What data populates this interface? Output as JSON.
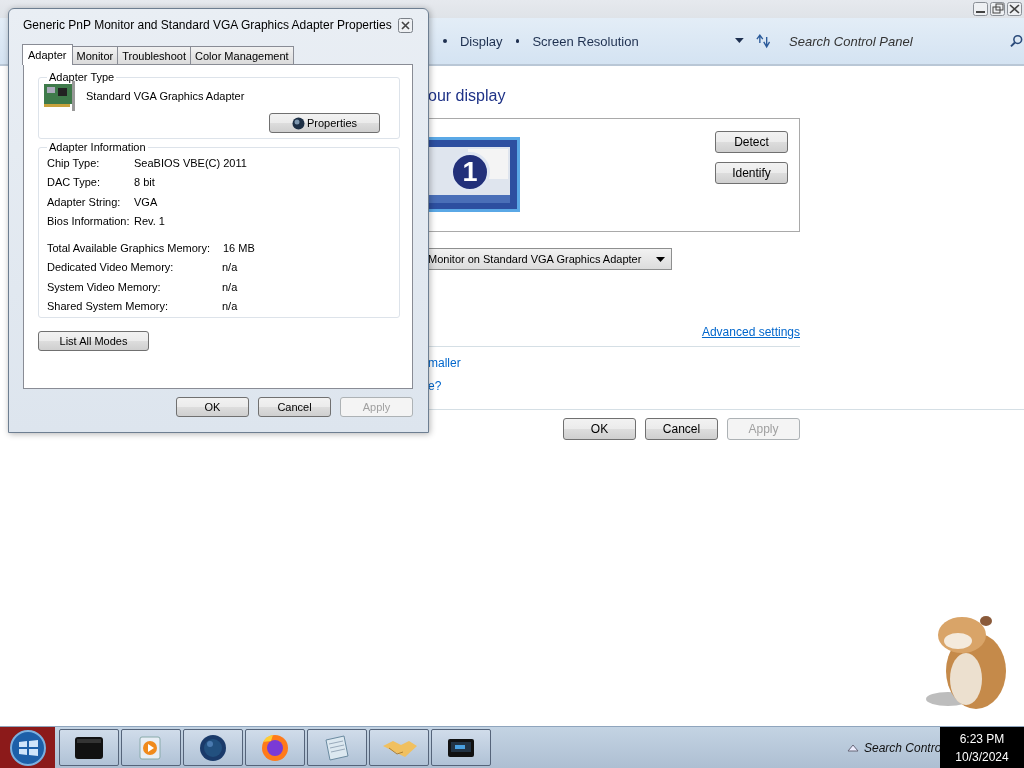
{
  "control_panel": {
    "breadcrumbs": [
      "Display",
      "Screen Resolution"
    ],
    "search": {
      "placeholder": "Search Control Panel"
    },
    "heading": "our display",
    "monitor_number": "1",
    "side_buttons": [
      "Detect",
      "Identify"
    ],
    "display_select": "Monitor on Standard VGA Graphics Adapter",
    "advanced_link": "Advanced settings",
    "links": [
      "maller",
      "e?"
    ],
    "buttons": [
      {
        "label": "OK",
        "disabled": false
      },
      {
        "label": "Cancel",
        "disabled": false
      },
      {
        "label": "Apply",
        "disabled": true
      }
    ]
  },
  "dialog": {
    "title": "Generic PnP Monitor and Standard VGA Graphics Adapter Properties",
    "tabs": [
      {
        "label": "Adapter",
        "selected": true
      },
      {
        "label": "Monitor",
        "selected": false
      },
      {
        "label": "Troubleshoot",
        "selected": false
      },
      {
        "label": "Color Management",
        "selected": false
      }
    ],
    "adapter_type": {
      "title": "Adapter Type",
      "name": "Standard VGA Graphics Adapter",
      "button": "Properties"
    },
    "adapter_info": {
      "title": "Adapter Information",
      "rows": [
        {
          "label": "Chip Type:",
          "value": "SeaBIOS VBE(C) 2011"
        },
        {
          "label": "DAC Type:",
          "value": "8 bit"
        },
        {
          "label": "Adapter String:",
          "value": "VGA"
        },
        {
          "label": "Bios Information:",
          "value": "Rev. 1"
        }
      ],
      "memory_rows": [
        {
          "label": "Total Available Graphics Memory:",
          "value": "16 MB"
        },
        {
          "label": "Dedicated Video Memory:",
          "value": "n/a"
        },
        {
          "label": "System Video Memory:",
          "value": "n/a"
        },
        {
          "label": "Shared System Memory:",
          "value": "n/a"
        }
      ]
    },
    "list_button": "List All Modes",
    "buttons": [
      {
        "label": "OK",
        "disabled": false
      },
      {
        "label": "Cancel",
        "disabled": false
      },
      {
        "label": "Apply",
        "disabled": true
      }
    ]
  },
  "taskbar": {
    "apps": [
      {
        "kind": "box"
      },
      {
        "kind": "player"
      },
      {
        "kind": "globe"
      },
      {
        "kind": "browser"
      },
      {
        "kind": "notepad"
      },
      {
        "kind": "handshake"
      },
      {
        "kind": "screen"
      }
    ],
    "tray": {
      "search_text": "Search Contro",
      "time": "6:23 PM",
      "date": "10/3/2024"
    }
  }
}
